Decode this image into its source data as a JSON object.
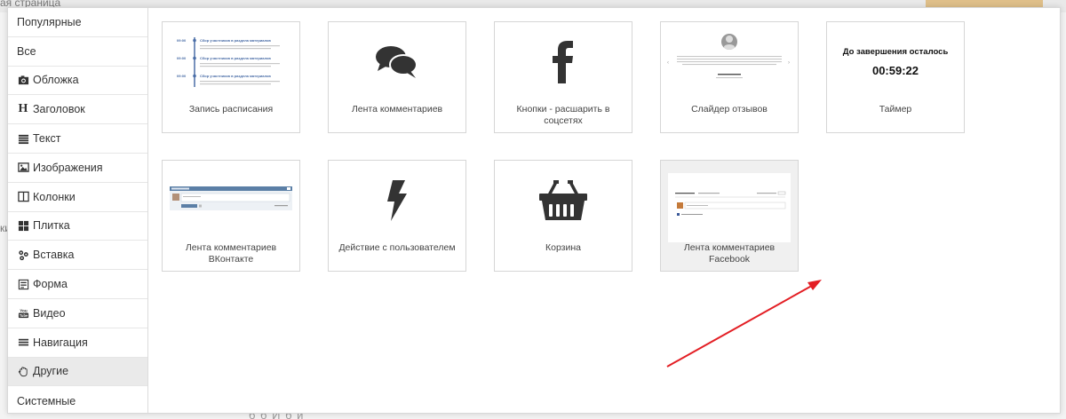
{
  "background": {
    "title_fragment": "ая страница",
    "side_fragment": "ки",
    "bottom_fragment": "б                              б      И                  б          й"
  },
  "sidebar": {
    "items": [
      {
        "label": "Популярные",
        "icon": "",
        "active": false
      },
      {
        "label": "Все",
        "icon": "",
        "active": false
      },
      {
        "label": "Обложка",
        "icon": "camera-icon",
        "active": false
      },
      {
        "label": "Заголовок",
        "icon": "heading-icon",
        "active": false
      },
      {
        "label": "Текст",
        "icon": "text-lines-icon",
        "active": false
      },
      {
        "label": "Изображения",
        "icon": "image-icon",
        "active": false
      },
      {
        "label": "Колонки",
        "icon": "columns-icon",
        "active": false
      },
      {
        "label": "Плитка",
        "icon": "tiles-icon",
        "active": false
      },
      {
        "label": "Вставка",
        "icon": "puzzle-icon",
        "active": false
      },
      {
        "label": "Форма",
        "icon": "form-icon",
        "active": false
      },
      {
        "label": "Видео",
        "icon": "youtube-icon",
        "active": false
      },
      {
        "label": "Навигация",
        "icon": "menu-icon",
        "active": false
      },
      {
        "label": "Другие",
        "icon": "hand-icon",
        "active": true
      },
      {
        "label": "Системные",
        "icon": "",
        "active": false
      }
    ]
  },
  "cards": [
    {
      "label": "Запись расписания",
      "thumb": "schedule-thumb",
      "schedule_time": "09:00",
      "schedule_title": "Сбор участников в раздела материалов"
    },
    {
      "label": "Лента комментариев",
      "thumb": "comments-icon"
    },
    {
      "label": "Кнопки - расшарить в соцсетях",
      "thumb": "facebook-icon"
    },
    {
      "label": "Слайдер отзывов",
      "thumb": "reviews-thumb"
    },
    {
      "label": "Таймер",
      "thumb": "timer-thumb",
      "timer_heading": "До завершения осталось",
      "timer_value": "00:59:22"
    },
    {
      "label": "Лента комментариев ВКонтакте",
      "thumb": "vk-comments-thumb"
    },
    {
      "label": "Действие с пользователем",
      "thumb": "lightning-icon"
    },
    {
      "label": "Корзина",
      "thumb": "basket-icon"
    },
    {
      "label": "Лента комментариев Facebook",
      "thumb": "fb-comments-thumb",
      "hover": true
    }
  ],
  "colors": {
    "arrow": "#e31e24",
    "accent_blue": "#4a6da7"
  }
}
